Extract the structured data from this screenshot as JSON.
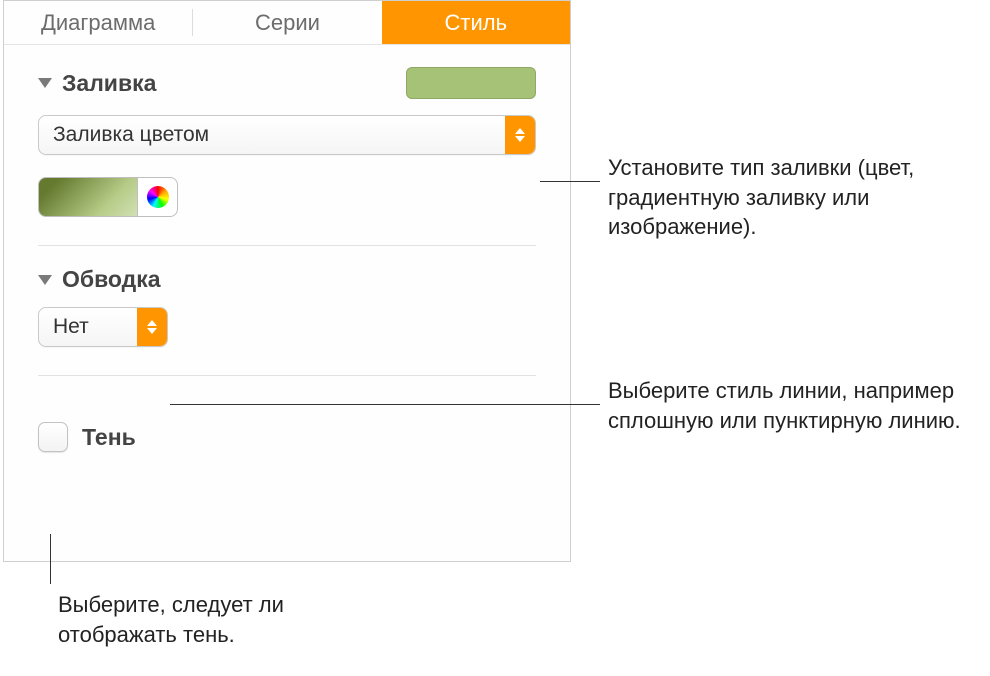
{
  "tabs": {
    "chart": "Диаграмма",
    "series": "Серии",
    "style": "Стиль"
  },
  "fill": {
    "section_label": "Заливка",
    "fill_type": "Заливка цветом",
    "swatch_color": "#a6c277"
  },
  "stroke": {
    "section_label": "Обводка",
    "value": "Нет"
  },
  "shadow": {
    "label": "Тень"
  },
  "callouts": {
    "fill_callout": "Установите тип заливки (цвет, градиентную заливку или изображение).",
    "stroke_callout": "Выберите стиль линии, например сплошную или пунктирную линию.",
    "shadow_callout": "Выберите, следует ли отображать тень."
  }
}
